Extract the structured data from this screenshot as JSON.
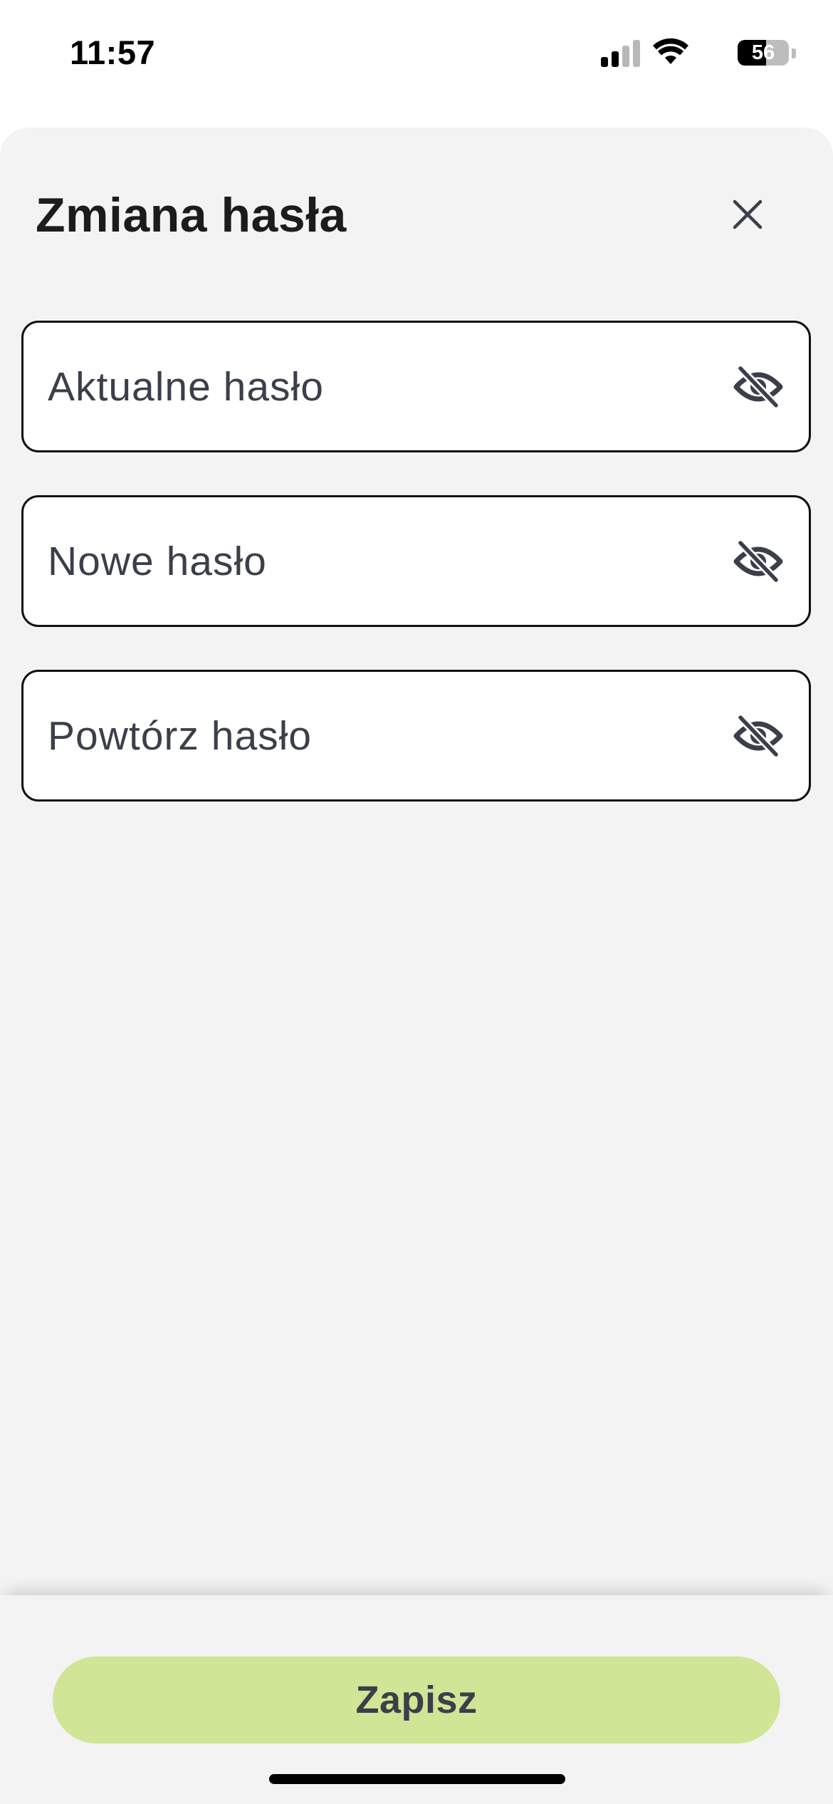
{
  "status_bar": {
    "time": "11:57",
    "battery_level": "56",
    "battery_fraction": 0.56,
    "signal_bars_active": 2,
    "signal_bars_total": 4
  },
  "sheet": {
    "title": "Zmiana hasła",
    "close_icon": "close-icon",
    "fields": [
      {
        "placeholder": "Aktualne hasło",
        "value": "",
        "toggle_icon": "eye-slash-icon"
      },
      {
        "placeholder": "Nowe hasło",
        "value": "",
        "toggle_icon": "eye-slash-icon"
      },
      {
        "placeholder": "Powtórz hasło",
        "value": "",
        "toggle_icon": "eye-slash-icon"
      }
    ]
  },
  "footer": {
    "save_label": "Zapisz"
  },
  "colors": {
    "sheet_background": "#f3f3f3",
    "save_button": "#d1e597",
    "text_primary": "#1c1c1e",
    "text_secondary": "#3b3f4a",
    "field_border": "#111111"
  }
}
